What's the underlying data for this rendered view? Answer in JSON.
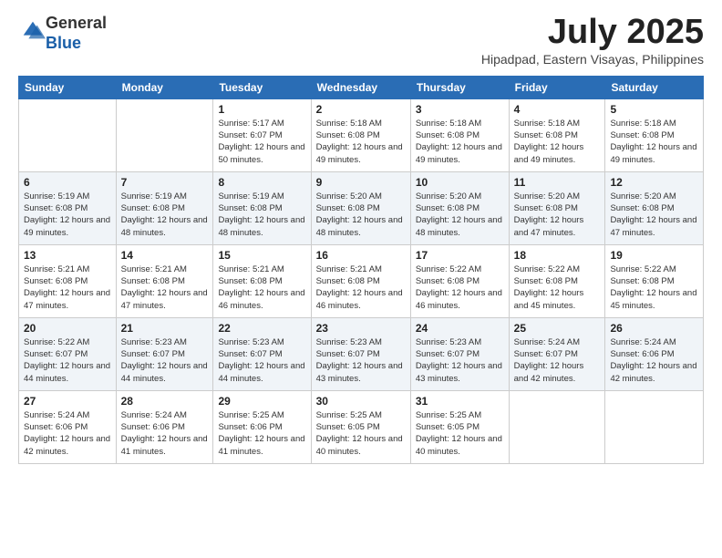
{
  "logo": {
    "line1": "General",
    "line2": "Blue"
  },
  "title": "July 2025",
  "subtitle": "Hipadpad, Eastern Visayas, Philippines",
  "days_of_week": [
    "Sunday",
    "Monday",
    "Tuesday",
    "Wednesday",
    "Thursday",
    "Friday",
    "Saturday"
  ],
  "weeks": [
    [
      null,
      null,
      {
        "day": 1,
        "sunrise": "5:17 AM",
        "sunset": "6:07 PM",
        "daylight": "12 hours and 50 minutes."
      },
      {
        "day": 2,
        "sunrise": "5:18 AM",
        "sunset": "6:08 PM",
        "daylight": "12 hours and 49 minutes."
      },
      {
        "day": 3,
        "sunrise": "5:18 AM",
        "sunset": "6:08 PM",
        "daylight": "12 hours and 49 minutes."
      },
      {
        "day": 4,
        "sunrise": "5:18 AM",
        "sunset": "6:08 PM",
        "daylight": "12 hours and 49 minutes."
      },
      {
        "day": 5,
        "sunrise": "5:18 AM",
        "sunset": "6:08 PM",
        "daylight": "12 hours and 49 minutes."
      }
    ],
    [
      {
        "day": 6,
        "sunrise": "5:19 AM",
        "sunset": "6:08 PM",
        "daylight": "12 hours and 49 minutes."
      },
      {
        "day": 7,
        "sunrise": "5:19 AM",
        "sunset": "6:08 PM",
        "daylight": "12 hours and 48 minutes."
      },
      {
        "day": 8,
        "sunrise": "5:19 AM",
        "sunset": "6:08 PM",
        "daylight": "12 hours and 48 minutes."
      },
      {
        "day": 9,
        "sunrise": "5:20 AM",
        "sunset": "6:08 PM",
        "daylight": "12 hours and 48 minutes."
      },
      {
        "day": 10,
        "sunrise": "5:20 AM",
        "sunset": "6:08 PM",
        "daylight": "12 hours and 48 minutes."
      },
      {
        "day": 11,
        "sunrise": "5:20 AM",
        "sunset": "6:08 PM",
        "daylight": "12 hours and 47 minutes."
      },
      {
        "day": 12,
        "sunrise": "5:20 AM",
        "sunset": "6:08 PM",
        "daylight": "12 hours and 47 minutes."
      }
    ],
    [
      {
        "day": 13,
        "sunrise": "5:21 AM",
        "sunset": "6:08 PM",
        "daylight": "12 hours and 47 minutes."
      },
      {
        "day": 14,
        "sunrise": "5:21 AM",
        "sunset": "6:08 PM",
        "daylight": "12 hours and 47 minutes."
      },
      {
        "day": 15,
        "sunrise": "5:21 AM",
        "sunset": "6:08 PM",
        "daylight": "12 hours and 46 minutes."
      },
      {
        "day": 16,
        "sunrise": "5:21 AM",
        "sunset": "6:08 PM",
        "daylight": "12 hours and 46 minutes."
      },
      {
        "day": 17,
        "sunrise": "5:22 AM",
        "sunset": "6:08 PM",
        "daylight": "12 hours and 46 minutes."
      },
      {
        "day": 18,
        "sunrise": "5:22 AM",
        "sunset": "6:08 PM",
        "daylight": "12 hours and 45 minutes."
      },
      {
        "day": 19,
        "sunrise": "5:22 AM",
        "sunset": "6:08 PM",
        "daylight": "12 hours and 45 minutes."
      }
    ],
    [
      {
        "day": 20,
        "sunrise": "5:22 AM",
        "sunset": "6:07 PM",
        "daylight": "12 hours and 44 minutes."
      },
      {
        "day": 21,
        "sunrise": "5:23 AM",
        "sunset": "6:07 PM",
        "daylight": "12 hours and 44 minutes."
      },
      {
        "day": 22,
        "sunrise": "5:23 AM",
        "sunset": "6:07 PM",
        "daylight": "12 hours and 44 minutes."
      },
      {
        "day": 23,
        "sunrise": "5:23 AM",
        "sunset": "6:07 PM",
        "daylight": "12 hours and 43 minutes."
      },
      {
        "day": 24,
        "sunrise": "5:23 AM",
        "sunset": "6:07 PM",
        "daylight": "12 hours and 43 minutes."
      },
      {
        "day": 25,
        "sunrise": "5:24 AM",
        "sunset": "6:07 PM",
        "daylight": "12 hours and 42 minutes."
      },
      {
        "day": 26,
        "sunrise": "5:24 AM",
        "sunset": "6:06 PM",
        "daylight": "12 hours and 42 minutes."
      }
    ],
    [
      {
        "day": 27,
        "sunrise": "5:24 AM",
        "sunset": "6:06 PM",
        "daylight": "12 hours and 42 minutes."
      },
      {
        "day": 28,
        "sunrise": "5:24 AM",
        "sunset": "6:06 PM",
        "daylight": "12 hours and 41 minutes."
      },
      {
        "day": 29,
        "sunrise": "5:25 AM",
        "sunset": "6:06 PM",
        "daylight": "12 hours and 41 minutes."
      },
      {
        "day": 30,
        "sunrise": "5:25 AM",
        "sunset": "6:05 PM",
        "daylight": "12 hours and 40 minutes."
      },
      {
        "day": 31,
        "sunrise": "5:25 AM",
        "sunset": "6:05 PM",
        "daylight": "12 hours and 40 minutes."
      },
      null,
      null
    ]
  ]
}
